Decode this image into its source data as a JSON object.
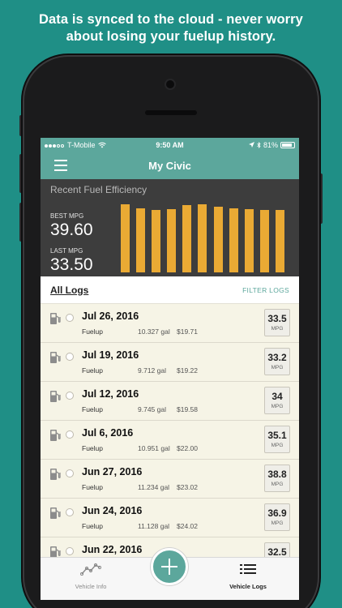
{
  "caption": {
    "line1": "Data is synced to the cloud - never worry",
    "line2": "about losing your fuelup history."
  },
  "status_bar": {
    "carrier": "T-Mobile",
    "time": "9:50 AM",
    "battery": "81%"
  },
  "nav": {
    "title": "My Civic"
  },
  "efficiency": {
    "title": "Recent Fuel Efficiency",
    "best_label": "BEST MPG",
    "best_value": "39.60",
    "last_label": "LAST MPG",
    "last_value": "33.50"
  },
  "chart_data": {
    "type": "bar",
    "values": [
      39.6,
      37.3,
      36.2,
      36.6,
      38.9,
      39.6,
      38.0,
      37.4,
      36.6,
      36.4,
      36.3
    ],
    "ylim": [
      0,
      40
    ],
    "color": "#eaaa34"
  },
  "logs_header": {
    "title": "All Logs",
    "filter": "FILTER LOGS"
  },
  "logs": [
    {
      "date": "Jul 26, 2016",
      "type": "Fuelup",
      "gallons": "10.327 gal",
      "cost": "$19.71",
      "mpg": "33.5",
      "unit": "MPG"
    },
    {
      "date": "Jul 19, 2016",
      "type": "Fuelup",
      "gallons": "9.712 gal",
      "cost": "$19.22",
      "mpg": "33.2",
      "unit": "MPG"
    },
    {
      "date": "Jul 12, 2016",
      "type": "Fuelup",
      "gallons": "9.745 gal",
      "cost": "$19.58",
      "mpg": "34",
      "unit": "MPG"
    },
    {
      "date": "Jul 6, 2016",
      "type": "Fuelup",
      "gallons": "10.951 gal",
      "cost": "$22.00",
      "mpg": "35.1",
      "unit": "MPG"
    },
    {
      "date": "Jun 27, 2016",
      "type": "Fuelup",
      "gallons": "11.234 gal",
      "cost": "$23.02",
      "mpg": "38.8",
      "unit": "MPG"
    },
    {
      "date": "Jun 24, 2016",
      "type": "Fuelup",
      "gallons": "11.128 gal",
      "cost": "$24.02",
      "mpg": "36.9",
      "unit": "MPG"
    },
    {
      "date": "Jun 22, 2016",
      "type": "",
      "gallons": "",
      "cost": "",
      "mpg": "32.5",
      "unit": ""
    }
  ],
  "tabs": {
    "vehicle_info": "Vehicle Info",
    "vehicle_logs": "Vehicle Logs"
  },
  "colors": {
    "background": "#1f8f86",
    "accent": "#5ca79c",
    "bar": "#eaaa34"
  }
}
